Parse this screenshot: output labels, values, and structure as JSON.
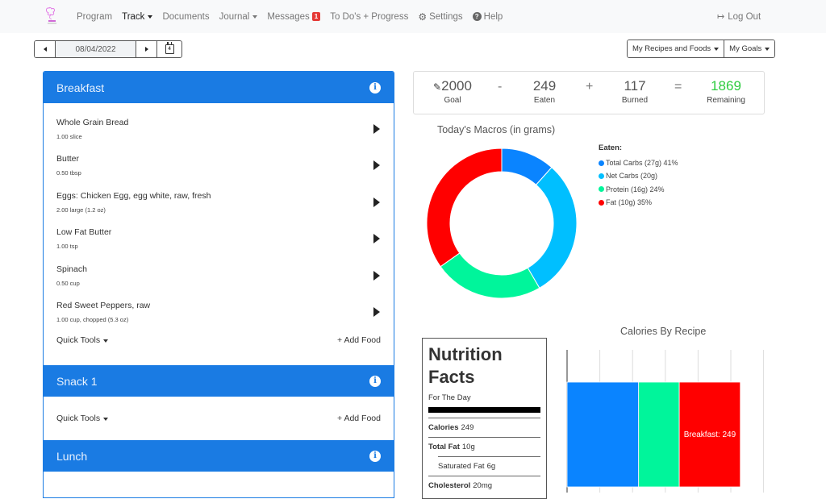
{
  "nav": {
    "items": [
      {
        "label": "Program"
      },
      {
        "label": "Track",
        "active": true,
        "dropdown": true
      },
      {
        "label": "Documents"
      },
      {
        "label": "Journal",
        "dropdown": true
      },
      {
        "label": "Messages",
        "badge": "1"
      },
      {
        "label": "To Do's + Progress"
      },
      {
        "label": "Settings",
        "icon": "gear-icon"
      },
      {
        "label": "Help",
        "icon": "question-circle-icon"
      }
    ],
    "logout": "Log Out"
  },
  "date": {
    "value": "08/04/2022",
    "calendar_day": "4"
  },
  "toolbar": {
    "recipes_label": "My Recipes and Foods",
    "goals_label": "My Goals"
  },
  "meals": [
    {
      "name": "Breakfast",
      "foods": [
        {
          "name": "Whole Grain Bread",
          "qty": "1.00 slice"
        },
        {
          "name": "Butter",
          "qty": "0.50 tbsp"
        },
        {
          "name": "Eggs: Chicken Egg, egg white, raw, fresh",
          "qty": "2.00 large (1.2 oz)"
        },
        {
          "name": "Low Fat Butter",
          "qty": "1.00 tsp"
        },
        {
          "name": "Spinach",
          "qty": "0.50 cup"
        },
        {
          "name": "Red Sweet Peppers, raw",
          "qty": "1.00 cup, chopped (5.3 oz)"
        }
      ],
      "quick_tools": "Quick Tools",
      "add_food": "+ Add Food"
    },
    {
      "name": "Snack 1",
      "foods": [],
      "quick_tools": "Quick Tools",
      "add_food": "+ Add Food"
    },
    {
      "name": "Lunch",
      "foods": []
    }
  ],
  "summary": {
    "goal": "2000",
    "goal_label": "Goal",
    "minus": "-",
    "eaten": "249",
    "eaten_label": "Eaten",
    "plus": "+",
    "burned": "117",
    "burned_label": "Burned",
    "equals": "=",
    "remaining": "1869",
    "remaining_label": "Remaining",
    "remaining_color": "#2ecc40"
  },
  "macros": {
    "title": "Today's Macros (in grams)",
    "legend_title": "Eaten:",
    "legend": [
      {
        "label": "Total Carbs (27g) 41%",
        "color": "#0a84ff"
      },
      {
        "label": "Net Carbs (20g)",
        "color": "#00bfff"
      },
      {
        "label": "Protein (16g) 24%",
        "color": "#00f59b"
      },
      {
        "label": "Fat (10g) 35%",
        "color": "#ff0000"
      }
    ]
  },
  "nutrition_facts": {
    "title_line1": "Nutrition",
    "title_line2": "Facts",
    "subtitle": "For The Day",
    "rows": [
      {
        "label": "Calories",
        "value": "249",
        "indent": false
      },
      {
        "label": "Total Fat",
        "value": "10g",
        "indent": false
      },
      {
        "label": "Saturated Fat",
        "value": "6g",
        "indent": true
      },
      {
        "label": "Cholesterol",
        "value": "20mg",
        "indent": false
      }
    ]
  },
  "chart_data": [
    {
      "type": "pie",
      "title": "Today's Macros (in grams)",
      "donut": true,
      "categories": [
        "Total Carbs",
        "Net Carbs",
        "Protein",
        "Fat"
      ],
      "values": [
        11.6,
        30.0,
        23.6,
        34.8
      ],
      "colors": [
        "#0a84ff",
        "#00bfff",
        "#00f59b",
        "#ff0000"
      ],
      "legend": "right"
    },
    {
      "type": "bar",
      "title": "Calories By Recipe",
      "orientation": "horizontal-stacked",
      "series": [
        {
          "name": "segment-1",
          "value": 292,
          "color": "#0a84ff",
          "label": ""
        },
        {
          "name": "segment-2",
          "value": 166,
          "color": "#00f59b",
          "label": ""
        },
        {
          "name": "Breakfast",
          "value": 249,
          "color": "#ff0000",
          "label": "Breakfast: 249"
        }
      ],
      "xlim": [
        0,
        800
      ],
      "grid": true
    }
  ]
}
